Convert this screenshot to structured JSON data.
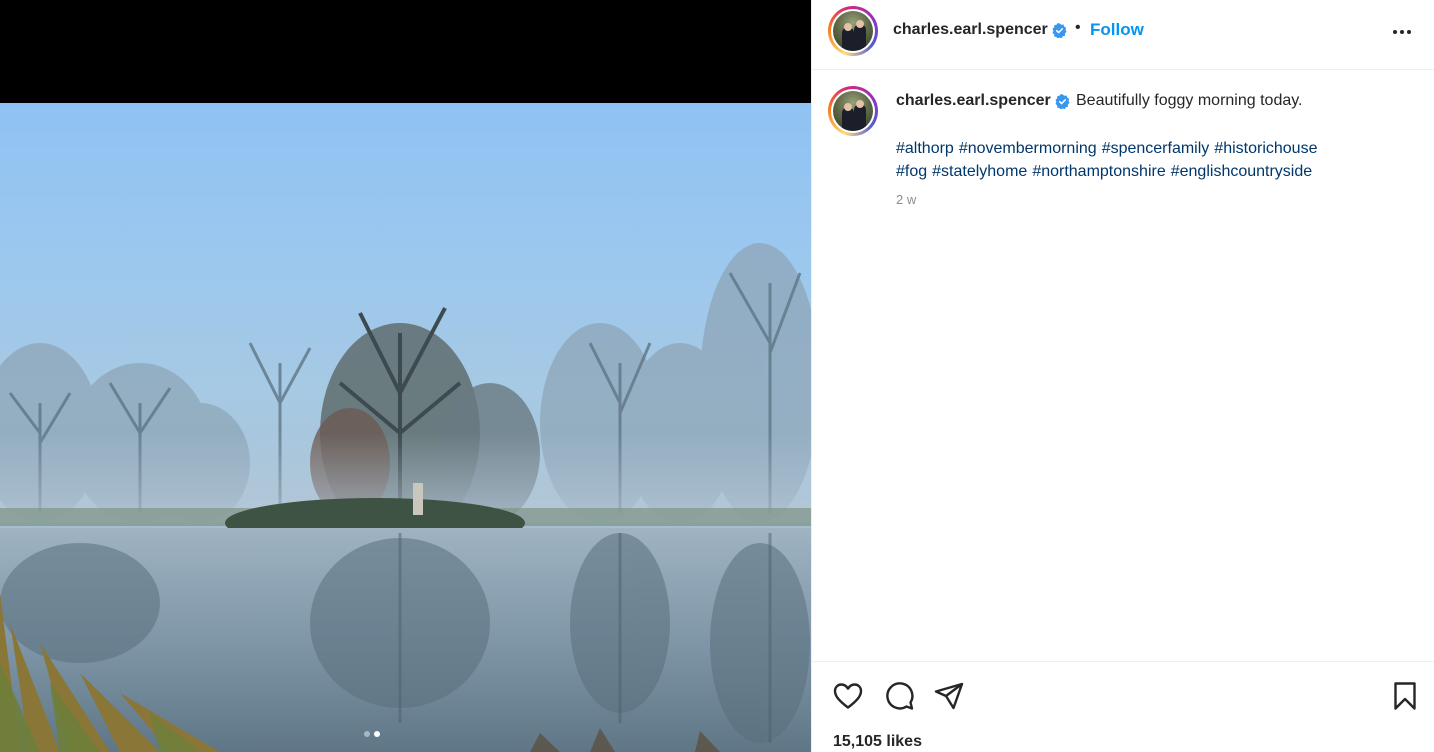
{
  "post": {
    "username": "charles.earl.spencer",
    "follow_label": "Follow",
    "separator": "•",
    "caption": "Beautifully foggy morning today.",
    "hashtags": [
      "#althorp",
      "#novembermorning",
      "#spencerfamily",
      "#historichouse",
      "#fog",
      "#statelyhome",
      "#northamptonshire",
      "#englishcountryside"
    ],
    "time_ago": "2 w",
    "likes": "15,105 likes"
  },
  "carousel": {
    "count": 2,
    "active_index": 1
  },
  "colors": {
    "accent": "#0095f6",
    "hashtag": "#00376b",
    "verified": "#3897f0",
    "muted": "#8e8e8e"
  },
  "icons": {
    "verified": "verified-badge-icon",
    "more": "more-options-icon",
    "like": "heart-icon",
    "comment": "comment-icon",
    "share": "paper-plane-icon",
    "save": "bookmark-icon"
  }
}
